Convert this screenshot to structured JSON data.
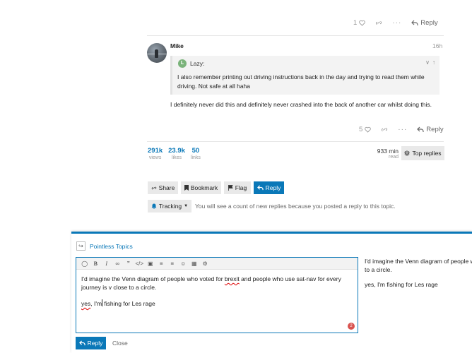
{
  "top_post": {
    "likes": "1",
    "reply_label": "Reply"
  },
  "mike_post": {
    "username": "Mike",
    "date": "16h",
    "quote": {
      "avatar_letter": "L",
      "user": "Lazy:",
      "text": "I also remember printing out driving instructions back in the day and trying to read them while driving. Not safe at all haha"
    },
    "text": "I definitely never did this and definitely never crashed into the back of another car whilst doing this.",
    "likes": "5",
    "reply_label": "Reply"
  },
  "stats": {
    "items": [
      {
        "value": "291k",
        "label": "views"
      },
      {
        "value": "23.9k",
        "label": "likes"
      },
      {
        "value": "50",
        "label": "links"
      }
    ],
    "read_time_value": "933 min",
    "read_time_label": "read",
    "top_replies_label": "Top replies"
  },
  "footer": {
    "share_label": "Share",
    "bookmark_label": "Bookmark",
    "flag_label": "Flag",
    "reply_label": "Reply",
    "tracking_label": "Tracking",
    "tracking_text": "You will see a count of new replies because you posted a reply to this topic."
  },
  "composer": {
    "topic_title": "Pointless Topics",
    "line1_before": "I'd imagine the Venn diagram of people who voted for ",
    "line1_misspelled": "brexit",
    "line1_after": " and people who use sat-nav for every journey is v close to a circle.",
    "line2_misspelled": "yes",
    "line2_a": ", I'm",
    "line2_b": " fishing for Les rage",
    "error_count": "2",
    "preview_line1": "I'd imagine the Venn diagram of people who",
    "preview_line2": "to a circle.",
    "preview_line3": "yes, I'm fishing for Les rage",
    "reply_label": "Reply",
    "close_label": "Close"
  },
  "colors": {
    "accent": "#0a78b8",
    "button_bg": "#e9e9e9",
    "error": "#d9534f"
  },
  "icons": [
    "heart-icon",
    "link-icon",
    "ellipsis-icon",
    "reply-arrow-icon",
    "layers-icon",
    "share-link-icon",
    "bookmark-icon",
    "flag-icon",
    "bell-icon",
    "caret-down-icon",
    "chevron-down-icon",
    "arrow-up-icon",
    "emoji-icon",
    "calendar-icon",
    "gear-icon"
  ]
}
